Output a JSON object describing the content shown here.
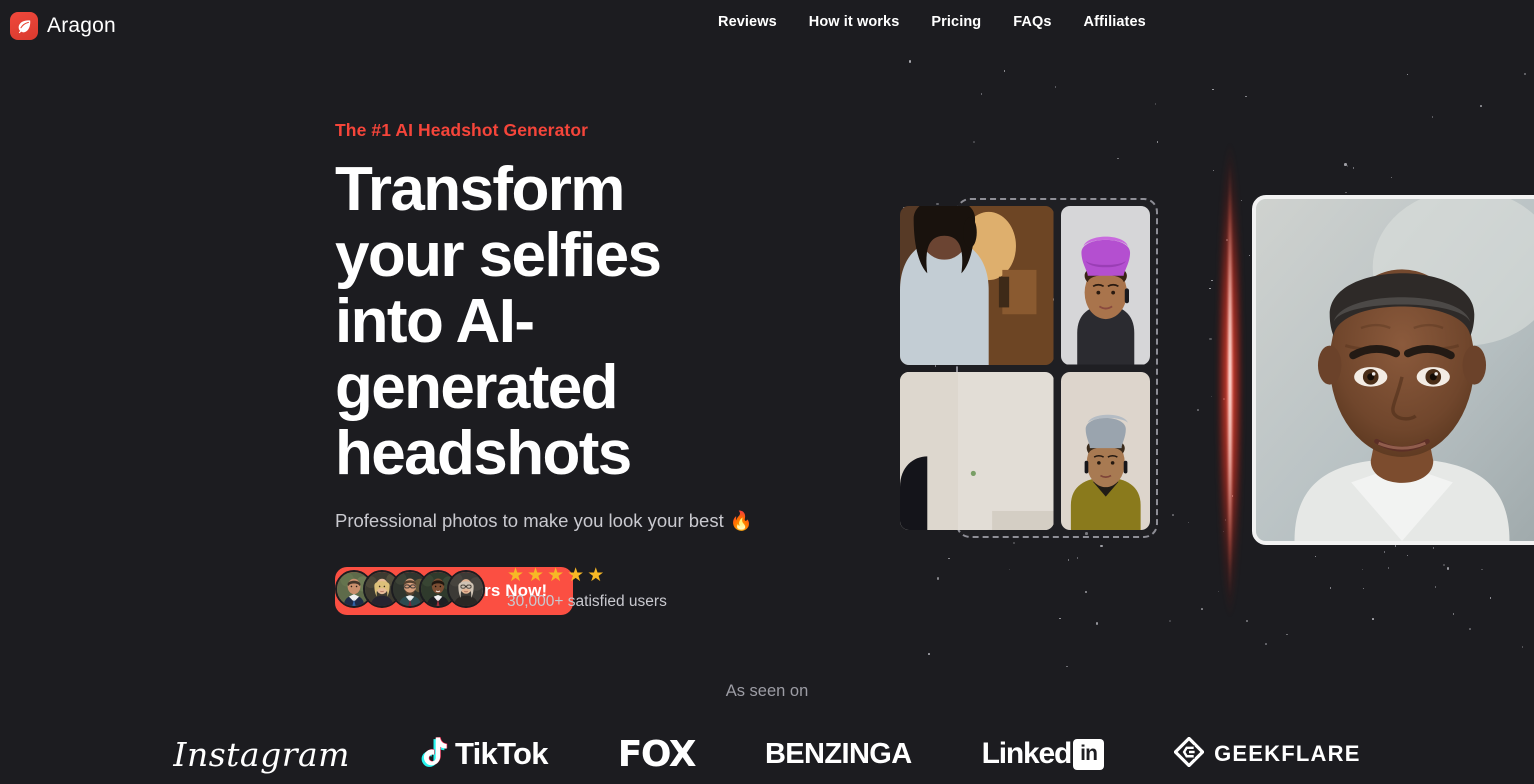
{
  "brand": {
    "name": "Aragon",
    "mark_icon": "leaf-icon",
    "mark_color": "#e8412f"
  },
  "nav": {
    "items": [
      {
        "label": "Reviews"
      },
      {
        "label": "How it works"
      },
      {
        "label": "Pricing"
      },
      {
        "label": "FAQs"
      },
      {
        "label": "Affiliates"
      }
    ]
  },
  "hero": {
    "eyebrow": "The #1 AI Headshot Generator",
    "eyebrow_color": "#f5453a",
    "headline": "Transform your selfies into AI-generated headshots",
    "subhead": "Professional photos to make you look your best",
    "subhead_emoji": "🔥",
    "cta": {
      "label": "Create Yours Now!",
      "icon": "sparkle-icon",
      "color": "#fb4f42"
    }
  },
  "social_proof": {
    "avatar_count": 5,
    "avatars": [
      {
        "alt": "smiling man in navy suit and blue tie"
      },
      {
        "alt": "blonde woman in dark blazer"
      },
      {
        "alt": "bearded man with glasses in teal suit"
      },
      {
        "alt": "man in dark suit with red tie"
      },
      {
        "alt": "woman with glasses and curly light hair"
      }
    ],
    "stars": 5,
    "star_glyph": "★",
    "star_color": "#f7b825",
    "count_label": "30,000+ satisfied users"
  },
  "visual": {
    "selfie_frame": {
      "border_style": "dashed",
      "photos": [
        {
          "alt": "selfie of woman in grey shirt indoors warm lamp"
        },
        {
          "alt": "woman wearing purple head wrap on grey background"
        },
        {
          "alt": "selfie against pale wall"
        },
        {
          "alt": "woman wearing grey head wrap in olive top"
        }
      ]
    },
    "beam": {
      "color": "#e8412f",
      "core_color": "#ffffff"
    },
    "result": {
      "alt": "professional AI headshot of a man in light grey blazer",
      "border_color": "#f2f2f2"
    }
  },
  "as_seen_on": {
    "label": "As seen on",
    "logos": [
      {
        "name": "Instagram"
      },
      {
        "name": "TikTok"
      },
      {
        "name": "FOX"
      },
      {
        "name": "BENZINGA"
      },
      {
        "name": "Linked",
        "suffix": "in"
      },
      {
        "name": "GEEKFLARE"
      }
    ]
  },
  "theme": {
    "background": "#1c1c20",
    "accent": "#fb4f42",
    "text": "#ffffff",
    "muted_text": "#9c9ca4"
  }
}
